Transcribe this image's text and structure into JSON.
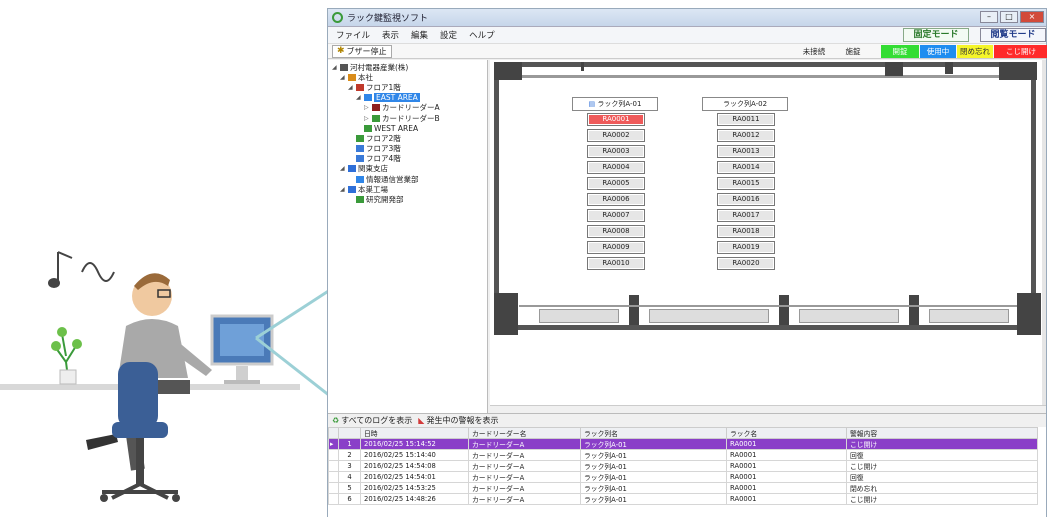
{
  "window": {
    "title": "ラック鍵監視ソフト",
    "controls": [
      "–",
      "□",
      "×"
    ]
  },
  "menu": [
    "ファイル",
    "表示",
    "編集",
    "設定",
    "ヘルプ"
  ],
  "modes": {
    "fixed": "固定モード",
    "view": "閲覧モード"
  },
  "toolbar": {
    "buzzer_label": "ブザー停止",
    "legend": {
      "unconnected": "未接続",
      "locked": "施錠",
      "open": "開錠",
      "in_use": "使用中",
      "forgot": "閉め忘れ",
      "force": "こじ開け"
    },
    "legend_colors": {
      "open": "#33dd33",
      "in_use": "#1e8df0",
      "forgot": "#f5f52a",
      "force": "#ff2a2a"
    }
  },
  "tree": [
    {
      "label": "河村電器産業(株)",
      "level": 0,
      "expander": "◢",
      "icon": "building-icon",
      "color": "#555"
    },
    {
      "label": "本社",
      "level": 1,
      "expander": "◢",
      "icon": "office-icon",
      "color": "#d98c1a"
    },
    {
      "label": "フロア1階",
      "level": 2,
      "expander": "◢",
      "icon": "floor-icon",
      "color": "#c0392b"
    },
    {
      "label": "EAST AREA",
      "level": 3,
      "expander": "◢",
      "icon": "area-icon",
      "color": "#2f86e8",
      "selected": true
    },
    {
      "label": "カードリーダーA",
      "level": 4,
      "expander": "▷",
      "icon": "card-reader-icon",
      "color": "#8e2020"
    },
    {
      "label": "カードリーダーB",
      "level": 4,
      "expander": "▷",
      "icon": "card-reader-icon",
      "color": "#3a9a3a"
    },
    {
      "label": "WEST AREA",
      "level": 3,
      "expander": "",
      "icon": "area-icon",
      "color": "#3a9a3a"
    },
    {
      "label": "フロア2階",
      "level": 2,
      "expander": "",
      "icon": "floor-icon",
      "color": "#3a9a3a"
    },
    {
      "label": "フロア3階",
      "level": 2,
      "expander": "",
      "icon": "floor-icon",
      "color": "#3a7ad8"
    },
    {
      "label": "フロア4階",
      "level": 2,
      "expander": "",
      "icon": "floor-icon",
      "color": "#3a7ad8"
    },
    {
      "label": "関東支店",
      "level": 1,
      "expander": "◢",
      "icon": "branch-icon",
      "color": "#2f6fd8"
    },
    {
      "label": "情報通信営業部",
      "level": 2,
      "expander": "",
      "icon": "department-icon",
      "color": "#2f86e8"
    },
    {
      "label": "本巣工場",
      "level": 1,
      "expander": "◢",
      "icon": "factory-icon",
      "color": "#2f6fd8"
    },
    {
      "label": "研究開発部",
      "level": 2,
      "expander": "",
      "icon": "department-icon",
      "color": "#3a9a3a"
    }
  ],
  "racks": [
    {
      "name": "ラック列A-01",
      "slots": [
        "RA0001",
        "RA0002",
        "RA0003",
        "RA0004",
        "RA0005",
        "RA0006",
        "RA0007",
        "RA0008",
        "RA0009",
        "RA0010"
      ],
      "alarm_index": 0
    },
    {
      "name": "ラック列A-02",
      "slots": [
        "RA0011",
        "RA0012",
        "RA0013",
        "RA0014",
        "RA0015",
        "RA0016",
        "RA0017",
        "RA0018",
        "RA0019",
        "RA0020"
      ],
      "alarm_index": -1
    }
  ],
  "log_tabs": {
    "all": "すべてのログを表示",
    "active": "発生中の警報を表示"
  },
  "log_columns": [
    "日時",
    "カードリーダー名",
    "ラック列名",
    "ラック名",
    "警報内容"
  ],
  "log_rows": [
    {
      "no": "1",
      "time": "2016/02/25 15:14:52",
      "reader": "カードリーダーA",
      "row": "ラック列A-01",
      "rack": "RA0001",
      "event": "こじ開け",
      "selected": true
    },
    {
      "no": "2",
      "time": "2016/02/25 15:14:40",
      "reader": "カードリーダーA",
      "row": "ラック列A-01",
      "rack": "RA0001",
      "event": "回復"
    },
    {
      "no": "3",
      "time": "2016/02/25 14:54:08",
      "reader": "カードリーダーA",
      "row": "ラック列A-01",
      "rack": "RA0001",
      "event": "こじ開け"
    },
    {
      "no": "4",
      "time": "2016/02/25 14:54:01",
      "reader": "カードリーダーA",
      "row": "ラック列A-01",
      "rack": "RA0001",
      "event": "回復"
    },
    {
      "no": "5",
      "time": "2016/02/25 14:53:25",
      "reader": "カードリーダーA",
      "row": "ラック列A-01",
      "rack": "RA0001",
      "event": "閉め忘れ"
    },
    {
      "no": "6",
      "time": "2016/02/25 14:48:26",
      "reader": "カードリーダーA",
      "row": "ラック列A-01",
      "rack": "RA0001",
      "event": "こじ開け"
    }
  ]
}
